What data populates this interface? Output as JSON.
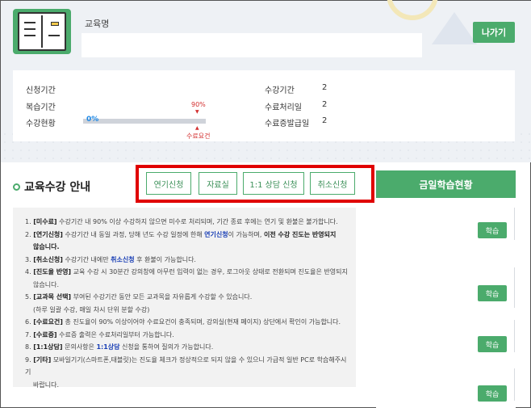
{
  "header": {
    "course_label": "교육명",
    "exit_label": "나가기"
  },
  "info": {
    "apply_period_label": "신청기간",
    "review_period_label": "복습기간",
    "status_label": "수강현황",
    "progress_value": "0%",
    "progress_fraction": 0,
    "required_pct": "90%",
    "required_label": "수료요건",
    "course_period_label": "수강기간",
    "course_period_value": "2",
    "completion_process_label": "수료처리일",
    "completion_process_value": "2",
    "certificate_label": "수료증발급일",
    "certificate_value": "2"
  },
  "section": {
    "title": "교육수강 안내"
  },
  "buttons": {
    "extend": "연기신청",
    "materials": "자료실",
    "consult": "1:1 상담 신청",
    "cancel": "취소신청"
  },
  "today": {
    "header": "금일학습현황",
    "study_label": "학습"
  },
  "notice": {
    "n1_num": "1.",
    "n1_key": "[미수료]",
    "n1_text": " 수강기간 내 90% 이상 수강하지 않으면 미수로 처리되며, 기간 종료 후에는 연기 및 환불은 불가합니다.",
    "n2_num": "2.",
    "n2_key": "[연기신청]",
    "n2_text_a": " 수강기간 내 동일 과정, 당해 년도 수강 일정에 한해 ",
    "n2_link": "연기신청",
    "n2_text_b": "이 가능하며, ",
    "n2_strong": "이전 수강 진도는 반영되지",
    "n2_cont": "않습니다.",
    "n3_num": "3.",
    "n3_key": "[취소신청]",
    "n3_text_a": " 수강기간 내에만 ",
    "n3_link": "취소신청",
    "n3_text_b": " 후 환불이 가능합니다.",
    "n4_num": "4.",
    "n4_key": "[진도율 반영]",
    "n4_text": " 교육 수강 시 30분간 강의창에 아무런 입력이 없는 경우, 로그아웃 상태로 전환되며 진도율은 반영되지",
    "n4_cont": "않습니다.",
    "n5_num": "5.",
    "n5_key": "[교과목 선택]",
    "n5_text": " 부여된 수강기간 동안 모든 교과목을 자유롭게 수강할 수 있습니다.",
    "n5_cont": "(하루 일괄 수강, 매일 차시 단위 분할 수강)",
    "n6_num": "6.",
    "n6_key": "[수료요건]",
    "n6_text": " 총 진도율이 90% 이상이어야 수료요건이 충족되며, 강의실(현재 페이지) 상단에서 확인이 가능합니다.",
    "n7_num": "7.",
    "n7_key": "[수료증]",
    "n7_text": " 수료증 출력은 수료처리일부터 가능합니다.",
    "n8_num": "8.",
    "n8_key": "[1:1상담]",
    "n8_text_a": " 문의사항은 ",
    "n8_link": "1:1상담",
    "n8_text_b": " 신청을 통하여 질의가 가능합니다.",
    "n9_num": "9.",
    "n9_key": "[기타]",
    "n9_text": " 모바일기기(스마트폰,태블릿)는 진도율 체크가 정상적으로 되지 않을 수 있으니 가급적 일반 PC로 학습해주시기",
    "n9_cont": "바랍니다."
  },
  "colors": {
    "accent_green": "#4bab6c",
    "highlight_red": "#e00000",
    "link_blue": "#1a3fb5",
    "progress_blue": "#1e88e5"
  },
  "icons": [
    "book-icon",
    "section-bullet-icon",
    "triangle-down-icon",
    "triangle-up-icon"
  ]
}
